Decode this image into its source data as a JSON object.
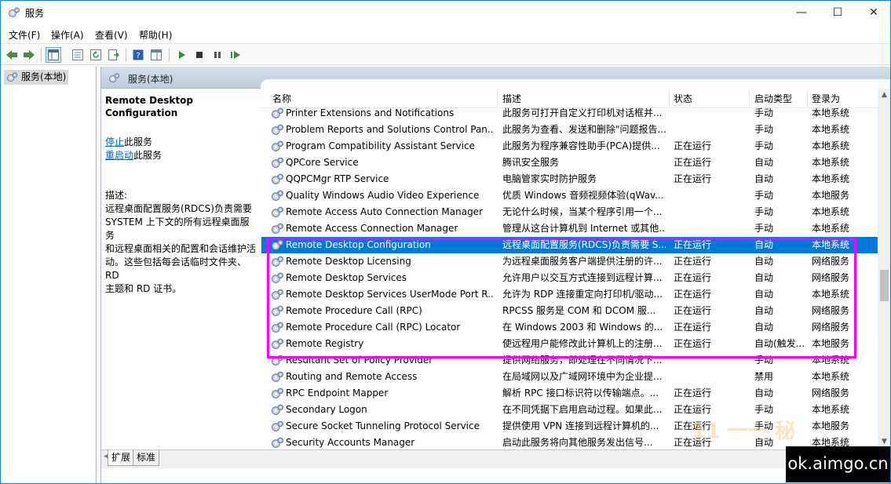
{
  "window": {
    "title": "服务",
    "controls": {
      "minimize": "—",
      "maximize": "☐",
      "close": "✕"
    }
  },
  "menubar": {
    "items": [
      "文件(F)",
      "操作(A)",
      "查看(V)",
      "帮助(H)"
    ]
  },
  "tree": {
    "root_label": "服务(本地)"
  },
  "panel": {
    "header_title": "服务(本地)",
    "selected_service": "Remote Desktop Configuration",
    "actions": [
      {
        "link": "停止",
        "suffix": "此服务"
      },
      {
        "link": "重启动",
        "suffix": "此服务"
      }
    ],
    "description_label": "描述:",
    "description_lines": [
      "远程桌面配置服务(RDCS)负责需要",
      "SYSTEM 上下文的所有远程桌面服务",
      "和远程桌面相关的配置和会话维护活",
      "动。这些包括每会话临时文件夹、RD",
      "主题和 RD 证书。"
    ]
  },
  "table": {
    "headers": {
      "name": "名称",
      "desc": "描述",
      "status": "状态",
      "startup": "启动类型",
      "logon": "登录为"
    },
    "sort_indicator": "^",
    "selected_index": 8,
    "rows": [
      {
        "name": "Printer Extensions and Notifications",
        "desc": "此服务可打开自定义打印机对话框并...",
        "status": "",
        "startup": "手动",
        "logon": "本地系统"
      },
      {
        "name": "Problem Reports and Solutions Control Pan...",
        "desc": "此服务为查看、发送和删除\"问题报告...",
        "status": "",
        "startup": "手动",
        "logon": "本地系统"
      },
      {
        "name": "Program Compatibility Assistant Service",
        "desc": "此服务为程序兼容性助手(PCA)提供...",
        "status": "正在运行",
        "startup": "手动",
        "logon": "本地系统"
      },
      {
        "name": "QPCore Service",
        "desc": "腾讯安全服务",
        "status": "正在运行",
        "startup": "自动",
        "logon": "本地系统"
      },
      {
        "name": "QQPCMgr RTP Service",
        "desc": "电脑管家实时防护服务",
        "status": "正在运行",
        "startup": "自动",
        "logon": "本地系统"
      },
      {
        "name": "Quality Windows Audio Video Experience",
        "desc": "优质 Windows 音频视频体验(qWav...",
        "status": "",
        "startup": "手动",
        "logon": "本地服务"
      },
      {
        "name": "Remote Access Auto Connection Manager",
        "desc": "无论什么时候，当某个程序引用一个...",
        "status": "",
        "startup": "手动",
        "logon": "本地系统"
      },
      {
        "name": "Remote Access Connection Manager",
        "desc": "管理从这台计算机到 Internet 或其他...",
        "status": "",
        "startup": "手动",
        "logon": "本地系统"
      },
      {
        "name": "Remote Desktop Configuration",
        "desc": "远程桌面配置服务(RDCS)负责需要 S...",
        "status": "正在运行",
        "startup": "自动",
        "logon": "本地系统"
      },
      {
        "name": "Remote Desktop Licensing",
        "desc": "为远程桌面服务客户端提供注册的许...",
        "status": "正在运行",
        "startup": "自动",
        "logon": "网络服务"
      },
      {
        "name": "Remote Desktop Services",
        "desc": "允许用户以交互方式连接到远程计算...",
        "status": "正在运行",
        "startup": "自动",
        "logon": "网络服务"
      },
      {
        "name": "Remote Desktop Services UserMode Port R...",
        "desc": "允许为 RDP 连接重定向打印机/驱动...",
        "status": "正在运行",
        "startup": "自动",
        "logon": "本地系统"
      },
      {
        "name": "Remote Procedure Call (RPC)",
        "desc": "RPCSS 服务是 COM 和 DCOM 服...",
        "status": "正在运行",
        "startup": "自动",
        "logon": "网络服务"
      },
      {
        "name": "Remote Procedure Call (RPC) Locator",
        "desc": "在 Windows 2003 和 Windows 的...",
        "status": "正在运行",
        "startup": "自动",
        "logon": "网络服务"
      },
      {
        "name": "Remote Registry",
        "desc": "使远程用户能修改此计算机上的注册...",
        "status": "正在运行",
        "startup": "自动(触发...",
        "logon": "本地服务"
      },
      {
        "name": "Resultant Set of Policy Provider",
        "desc": "提供网络服务，即处理在不同情况下...",
        "status": "",
        "startup": "手动",
        "logon": "本地系统"
      },
      {
        "name": "Routing and Remote Access",
        "desc": "在局域网以及广域网环境中为企业提...",
        "status": "",
        "startup": "禁用",
        "logon": "本地系统"
      },
      {
        "name": "RPC Endpoint Mapper",
        "desc": "解析 RPC 接口标识符以传输端点。...",
        "status": "正在运行",
        "startup": "自动",
        "logon": "网络服务"
      },
      {
        "name": "Secondary Logon",
        "desc": "在不同凭据下启用启动过程。如果此...",
        "status": "正在运行",
        "startup": "手动",
        "logon": "本地系统"
      },
      {
        "name": "Secure Socket Tunneling Protocol Service",
        "desc": "提供使用 VPN 连接到远程计算机的...",
        "status": "正在运行",
        "startup": "手动",
        "logon": "本地服务"
      },
      {
        "name": "Security Accounts Manager",
        "desc": "启动此服务将向其他服务发出信号...",
        "status": "正在运行",
        "startup": "自动",
        "logon": "本地系统"
      }
    ]
  },
  "tabs": {
    "extended": "扩展",
    "standard": "标准"
  },
  "watermark": {
    "text": "ok.aimgo.cn",
    "logo": "11 一一 秘"
  },
  "colors": {
    "selection": "#0078d7",
    "highlight_box": "#ff00ff",
    "link": "#0563c1"
  }
}
